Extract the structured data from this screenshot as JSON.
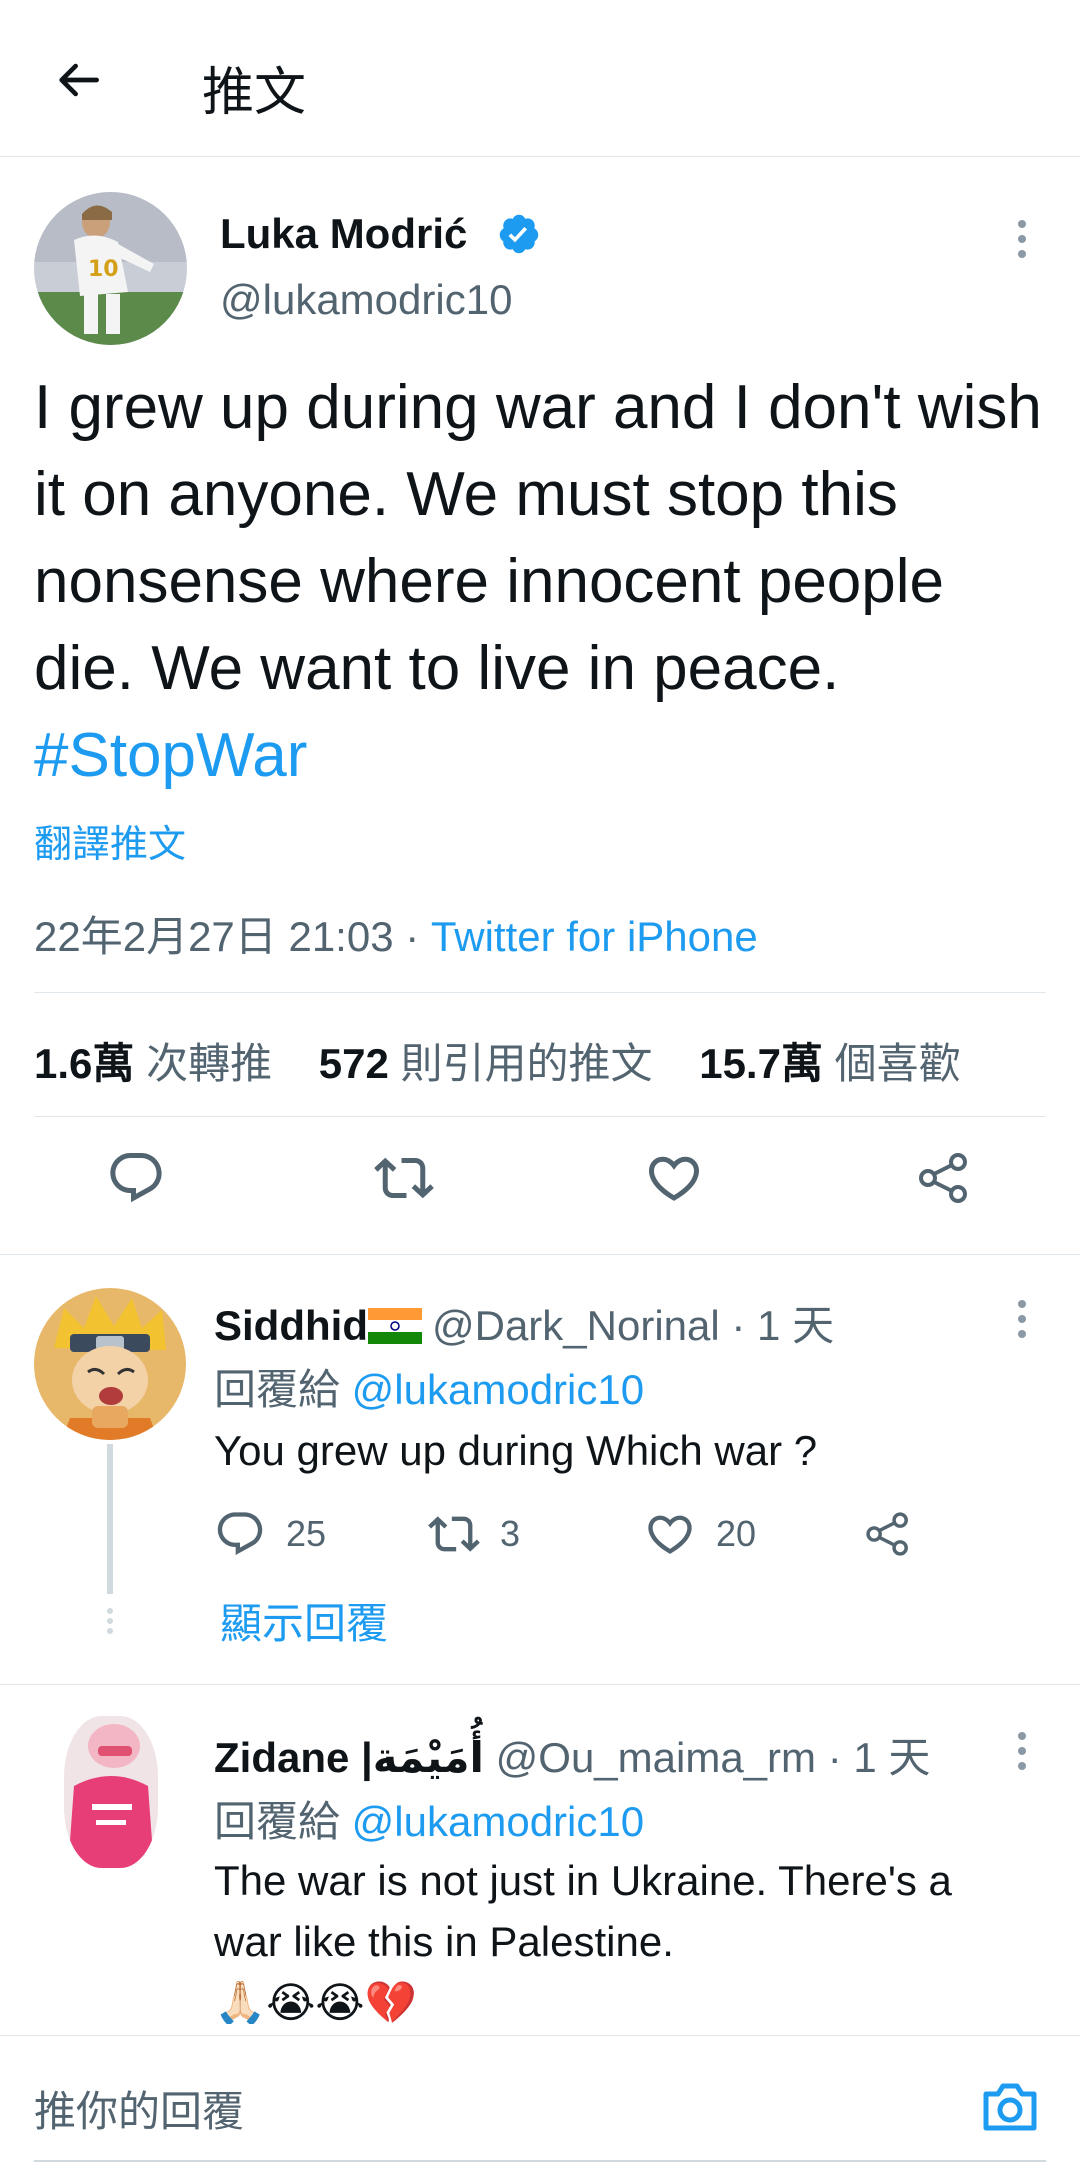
{
  "header": {
    "title": "推文",
    "back_icon": "arrow-left-icon"
  },
  "tweet": {
    "author": {
      "name": "Luka Modrić",
      "handle": "@lukamodric10",
      "verified": true,
      "jersey_number": "10"
    },
    "text": "I grew up during war and I don't wish it on anyone. We must stop this nonsense where innocent people die. We want to live in peace.",
    "hashtag": "#StopWar",
    "translate_label": "翻譯推文",
    "timestamp": "22年2月27日 21:03",
    "separator": " · ",
    "source": "Twitter for iPhone",
    "stats": {
      "retweets_num": "1.6萬",
      "retweets_label": "次轉推",
      "quotes_num": "572",
      "quotes_label": "則引用的推文",
      "likes_num": "15.7萬",
      "likes_label": "個喜歡"
    },
    "actions": [
      "reply-icon",
      "retweet-icon",
      "like-icon",
      "share-icon"
    ]
  },
  "replies": [
    {
      "name": "Siddhid",
      "flag_icon": "india-flag-icon",
      "handle": "@Dark_Norinal",
      "time": "· 1 天",
      "reply_to_prefix": "回覆給 ",
      "reply_to_handle": "@lukamodric10",
      "text": "You grew up during Which war ?",
      "counts": {
        "replies": "25",
        "retweets": "3",
        "likes": "20"
      },
      "show_replies_label": "顯示回覆"
    },
    {
      "name": "Zidane |أُمَيْمَة",
      "handle": "@Ou_maima_rm",
      "time": "· 1 天",
      "reply_to_prefix": "回覆給 ",
      "reply_to_handle": "@lukamodric10",
      "text_line1": "The war is not just in Ukraine. There's a",
      "text_line2": "war like this in Palestine.",
      "emoji_line": "🙏🏻😭😭💔"
    }
  ],
  "compose": {
    "placeholder": "推你的回覆",
    "camera_icon": "camera-icon"
  },
  "colors": {
    "accent": "#1d9bf0",
    "secondary_text": "#536471",
    "primary_text": "#0f1419",
    "divider": "#e1e8ed"
  }
}
